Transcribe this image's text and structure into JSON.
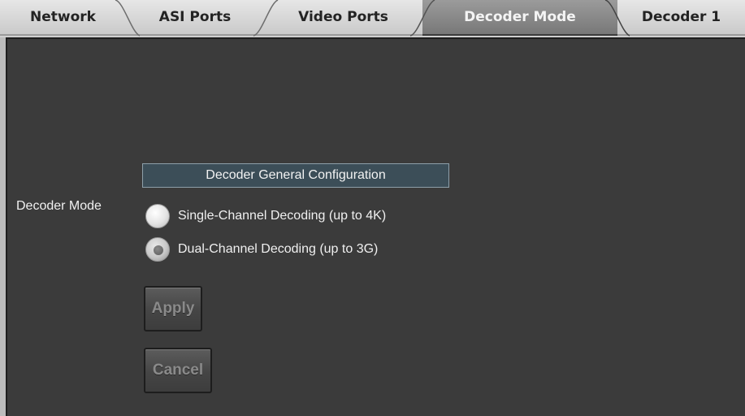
{
  "tabs": [
    {
      "label": "Network",
      "active": false
    },
    {
      "label": "ASI Ports",
      "active": false
    },
    {
      "label": "Video Ports",
      "active": false
    },
    {
      "label": "Decoder Mode",
      "active": true
    },
    {
      "label": "Decoder 1",
      "active": false
    }
  ],
  "section_title": "Decoder General Configuration",
  "decoder_mode": {
    "label": "Decoder Mode",
    "options": [
      {
        "label": "Single-Channel Decoding (up to 4K)",
        "selected": false
      },
      {
        "label": "Dual-Channel Decoding (up to 3G)",
        "selected": true
      }
    ]
  },
  "buttons": {
    "apply": "Apply",
    "cancel": "Cancel"
  },
  "colors": {
    "panel_background": "#3b3b3b",
    "header_background": "#3c4e58",
    "active_tab": "#8a8a8a"
  }
}
